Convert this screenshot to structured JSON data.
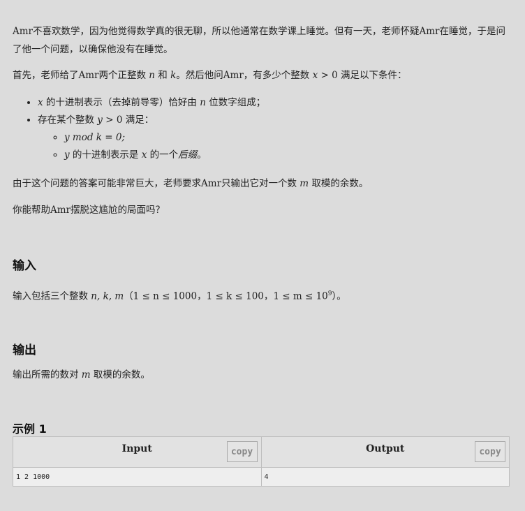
{
  "statement": {
    "p1": "Amr不喜欢数学，因为他觉得数学真的很无聊，所以他通常在数学课上睡觉。但有一天，老师怀疑Amr在睡觉，于是问了他一个问题，以确保他没有在睡觉。",
    "p2_a": "首先，老师给了Amr两个正整数 ",
    "p2_n": "n",
    "p2_b": " 和 ",
    "p2_k": "k",
    "p2_c": "。然后他问Amr，有多少个整数 ",
    "p2_x": "x",
    "p2_d": " > 0 满足以下条件：",
    "cond1_x": "x",
    "cond1_a": " 的十进制表示（去掉前导零）恰好由 ",
    "cond1_n": "n",
    "cond1_b": " 位数字组成；",
    "cond2_a": "存在某个整数 ",
    "cond2_y": "y",
    "cond2_b": " > 0 满足：",
    "sub1": "y mod k = 0;",
    "sub2_y": "y",
    "sub2_a": " 的十进制表示是 ",
    "sub2_x": "x",
    "sub2_b": " 的一个",
    "sub2_em": "后缀",
    "sub2_c": "。",
    "p3_a": "由于这个问题的答案可能非常巨大，老师要求Amr只输出它对一个数 ",
    "p3_m": "m",
    "p3_b": " 取模的余数。",
    "p4": "你能帮助Amr摆脱这尴尬的局面吗？"
  },
  "input_section": {
    "title": "输入",
    "text_a": "输入包括三个整数 ",
    "vars": "n, k, m",
    "text_b": "（1 ≤ n ≤ 1000，1 ≤ k ≤ 100，1 ≤ m ≤ 10",
    "sup": "9",
    "text_c": "）。"
  },
  "output_section": {
    "title": "输出",
    "text_a": "输出所需的数对 ",
    "m": "m",
    "text_b": " 取模的余数。"
  },
  "sample": {
    "title": "示例 1",
    "input_header": "Input",
    "output_header": "Output",
    "copy_label": "copy",
    "input_value": "1 2 1000",
    "output_value": "4"
  }
}
